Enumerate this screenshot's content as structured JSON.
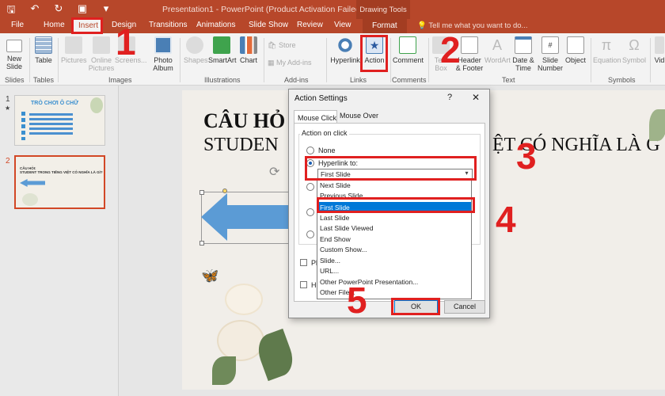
{
  "titlebar": {
    "title": "Presentation1 - PowerPoint (Product Activation Failed)",
    "context_title": "Drawing Tools"
  },
  "tabs": [
    "File",
    "Home",
    "Insert",
    "Design",
    "Transitions",
    "Animations",
    "Slide Show",
    "Review",
    "View",
    "Format"
  ],
  "active_tab": "Insert",
  "tell_me": "Tell me what you want to do...",
  "ribbon": {
    "new_slide": "New\nSlide",
    "table": "Table",
    "pictures": "Pictures",
    "online_pictures": "Online\nPictures",
    "screenshot": "Screens...",
    "photo_album": "Photo\nAlbum",
    "shapes": "Shapes",
    "smartart": "SmartArt",
    "chart": "Chart",
    "store": "Store",
    "my_addins": "My Add-ins",
    "hyperlink": "Hyperlink",
    "action": "Action",
    "comment": "Comment",
    "text_box": "Text\nBox",
    "header_footer": "Header\n& Footer",
    "wordart": "WordArt",
    "date_time": "Date &\nTime",
    "slide_number": "Slide\nNumber",
    "object": "Object",
    "equation": "Equation",
    "symbol": "Symbol",
    "video": "Vid",
    "groups": {
      "slides": "Slides",
      "tables": "Tables",
      "images": "Images",
      "illustrations": "Illustrations",
      "addins": "Add-ins",
      "links": "Links",
      "comments": "Comments",
      "text": "Text",
      "symbols": "Symbols"
    }
  },
  "thumbnails": {
    "slide1_num": "1",
    "slide1_star": "★",
    "slide1_title": "TRÒ CHƠI Ô CHỮ",
    "slide2_num": "2",
    "slide2_title": "CÂU HỎI:\nSTUDENT TRONG TIẾNG VIỆT CÓ NGHĨA LÀ GÌ?"
  },
  "slide": {
    "line1": "CÂU HỎ",
    "line2": "STUDEN",
    "line2b": "ỆT CÓ NGHĨA LÀ G"
  },
  "dialog": {
    "title": "Action Settings",
    "help": "?",
    "close": "✕",
    "tab_mouse_click": "Mouse Click",
    "tab_mouse_over": "Mouse Over",
    "action_label": "Action on click",
    "none": "None",
    "hyperlink_to": "Hyperlink to:",
    "combo_value": "First Slide",
    "options": [
      "Next Slide",
      "Previous Slide",
      "First Slide",
      "Last Slide",
      "Last Slide Viewed",
      "End Show",
      "Custom Show...",
      "Slide...",
      "URL...",
      "Other PowerPoint Presentation...",
      "Other File..."
    ],
    "selected_option": "First Slide",
    "play_sound": "Pl",
    "highlight": "Hi",
    "ok": "OK",
    "cancel": "Cancel"
  },
  "steps": [
    "1",
    "2",
    "3",
    "4",
    "5"
  ]
}
